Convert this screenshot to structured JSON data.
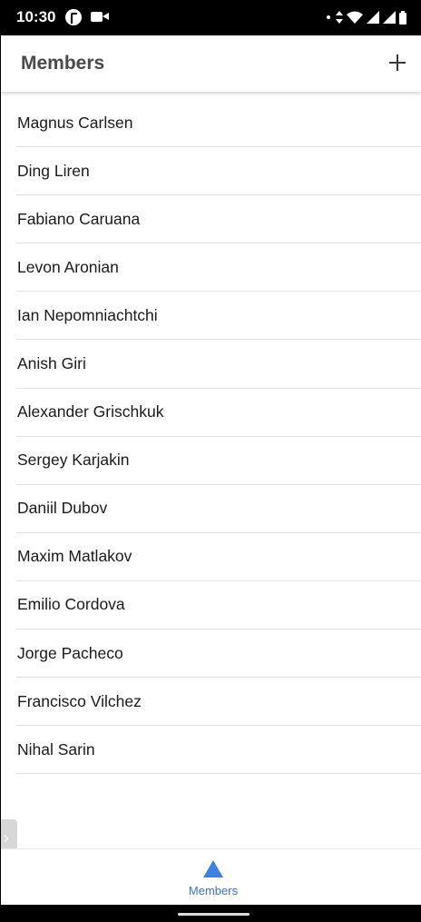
{
  "status_bar": {
    "time": "10:30",
    "icons": [
      "app-notification-icon",
      "video-camera-icon",
      "notification-dot-icon",
      "wifi-icon",
      "signal-icon",
      "signal-icon",
      "battery-icon"
    ]
  },
  "header": {
    "title": "Members",
    "add_icon": "plus-icon"
  },
  "members": [
    "Magnus Carlsen",
    "Ding Liren",
    "Fabiano Caruana",
    "Levon Aronian",
    "Ian Nepomniachtchi",
    "Anish Giri",
    "Alexander Grischkuk",
    "Sergey Karjakin",
    "Daniil Dubov",
    "Maxim Matlakov",
    "Emilio Cordova",
    "Jorge Pacheco",
    "Francisco Vilchez",
    "Nihal Sarin"
  ],
  "bottom_nav": {
    "items": [
      {
        "label": "Members",
        "icon": "triangle-icon",
        "active": true
      }
    ]
  },
  "colors": {
    "accent": "#3b82e4",
    "title": "#4a4a4a",
    "divider": "#e0e0e0"
  }
}
